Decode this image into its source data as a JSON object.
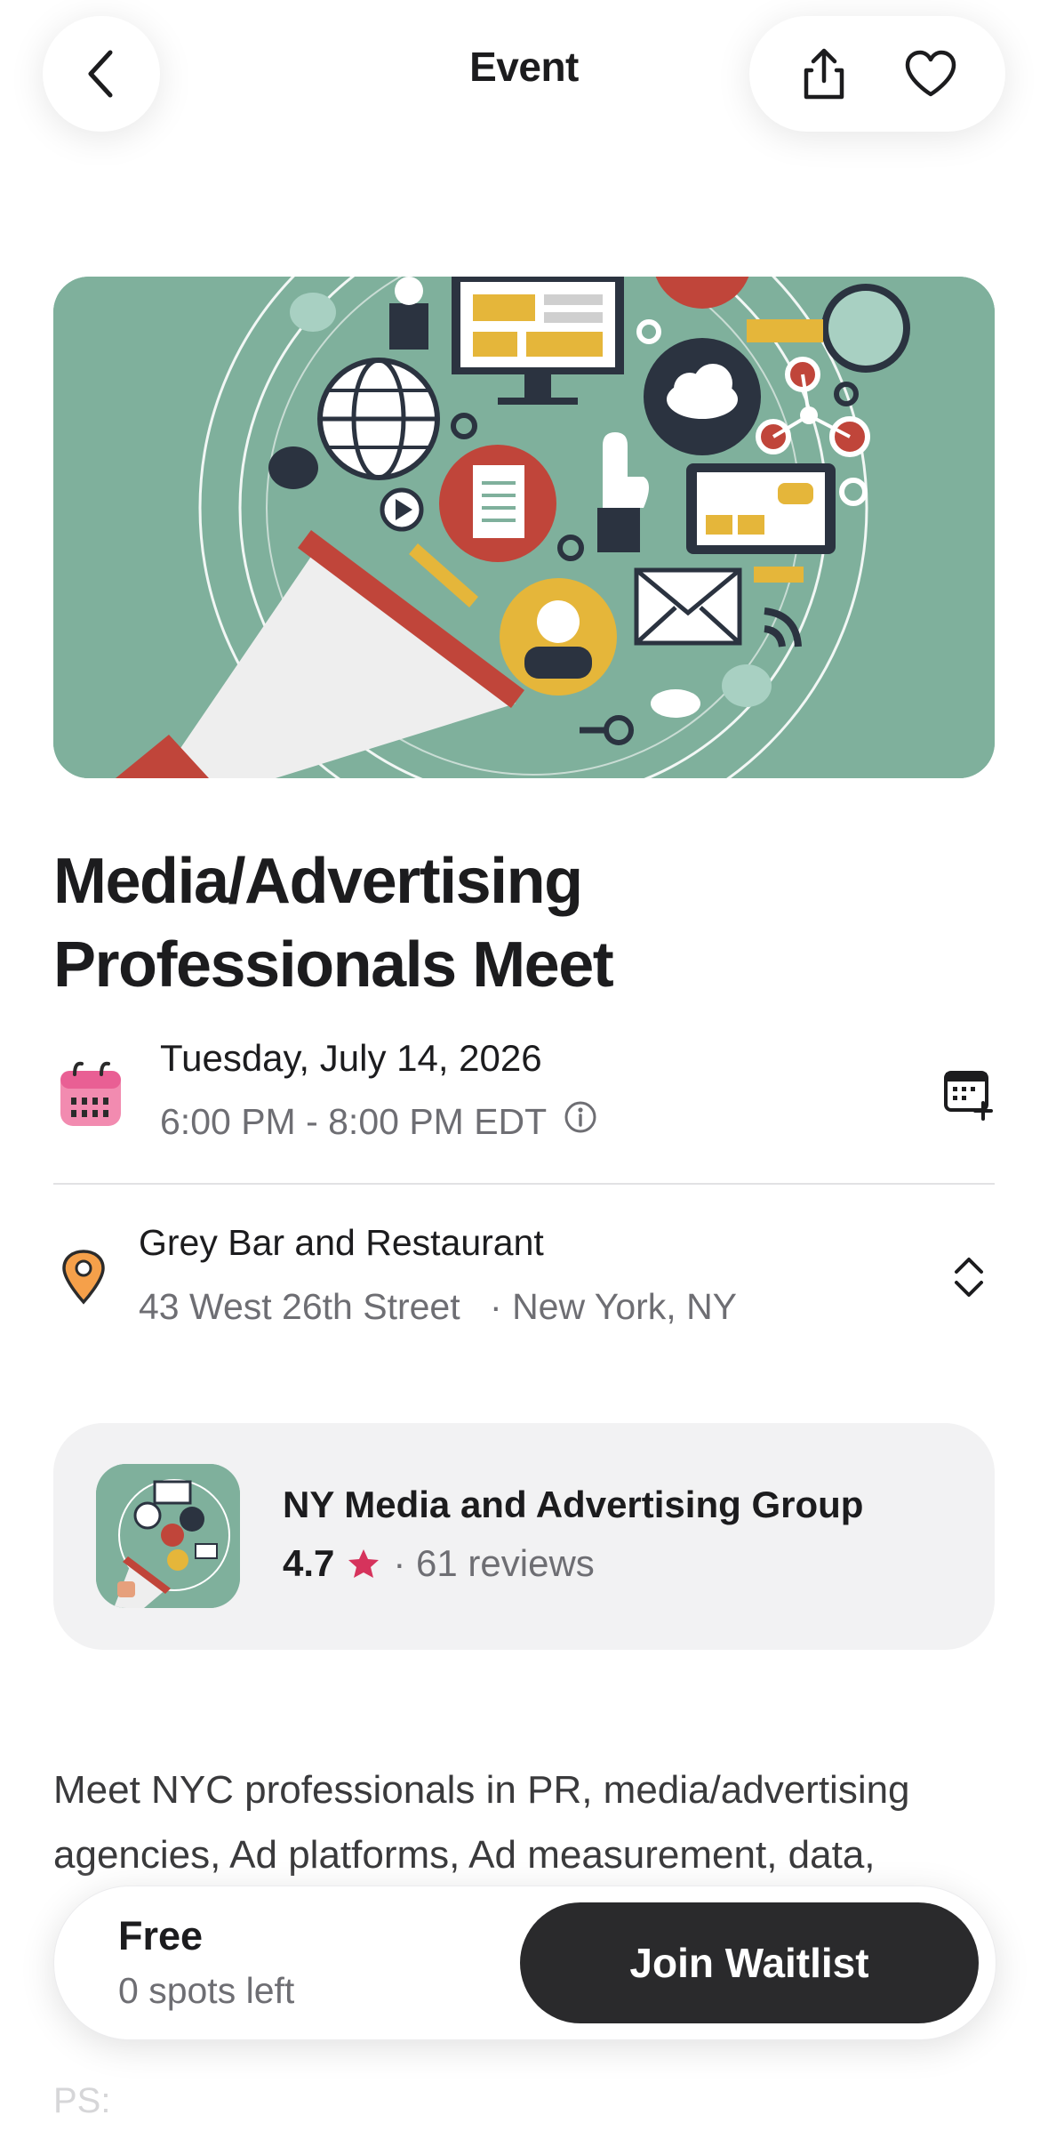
{
  "header": {
    "title": "Event"
  },
  "event": {
    "title_line1": "Media/Advertising",
    "title_line2": "Professionals Meet",
    "date": "Tuesday, July 14, 2026",
    "time": "6:00 PM - 8:00 PM EDT",
    "venue": {
      "name": "Grey Bar and Restaurant",
      "street": "43 West 26th Street",
      "city": "· New York, NY"
    }
  },
  "organizer": {
    "name": "NY Media and Advertising Group",
    "rating": "4.7",
    "reviews": "· 61 reviews"
  },
  "description": {
    "line1": "Meet NYC professionals in PR, media/advertising",
    "line2": "agencies, Ad platforms, Ad measurement, data,",
    "ps": "PS:"
  },
  "footer": {
    "price": "Free",
    "spots": "0 spots left",
    "cta": "Join Waitlist"
  },
  "colors": {
    "hero_bg": "#7fb09c",
    "accent_red": "#c0453a",
    "accent_yellow": "#e5b63a",
    "star": "#d6335c",
    "button_dark": "#2a2a2c"
  },
  "icons": [
    "back-icon",
    "share-icon",
    "heart-icon",
    "calendar-icon",
    "info-icon",
    "add-to-calendar-icon",
    "location-pin-icon",
    "expand-chevrons-icon",
    "star-icon"
  ]
}
